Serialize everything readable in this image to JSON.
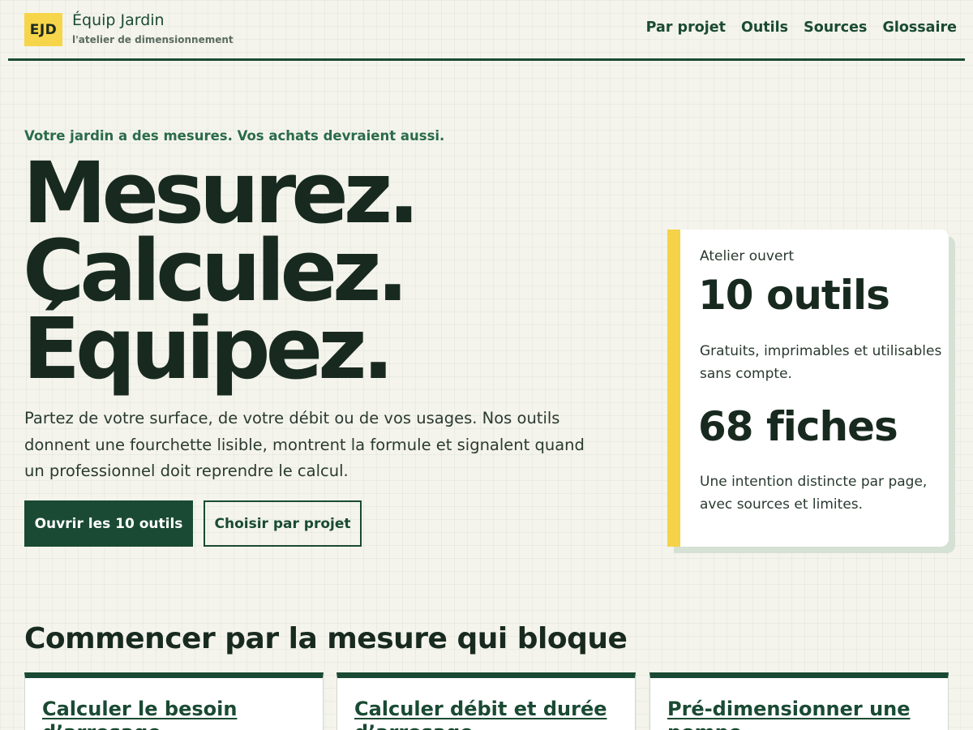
{
  "header": {
    "logo": "EJD",
    "brand_name": "Équip Jardin",
    "brand_tagline": "l'atelier de dimensionnement",
    "nav": [
      "Par projet",
      "Outils",
      "Sources",
      "Glossaire"
    ]
  },
  "hero": {
    "eyebrow": "Votre jardin a des mesures. Vos achats devraient aussi.",
    "title_lines": [
      "Mesurez.",
      "Calculez.",
      "Équipez."
    ],
    "description": "Partez de votre surface, de votre débit ou de vos usages. Nos outils donnent une fourchette lisible, montrent la formule et signalent quand un professionnel doit reprendre le calcul.",
    "primary_button": "Ouvrir les 10 outils",
    "secondary_button": "Choisir par projet"
  },
  "stats": {
    "label": "Atelier ouvert",
    "stat1_value": "10 outils",
    "stat1_text": "Gratuits, imprimables et utilisables sans compte.",
    "stat2_value": "68 fiches",
    "stat2_text": "Une intention distincte par page, avec sources et limites."
  },
  "section": {
    "title": "Commencer par la mesure qui bloque",
    "cards": [
      "Calculer le besoin d’arrosage",
      "Calculer débit et durée d’arrosage",
      "Pré-dimensionner une pompe"
    ]
  },
  "colors": {
    "brand_green": "#1a4a33",
    "accent_yellow": "#f5d247",
    "background": "#f4f4ec"
  }
}
